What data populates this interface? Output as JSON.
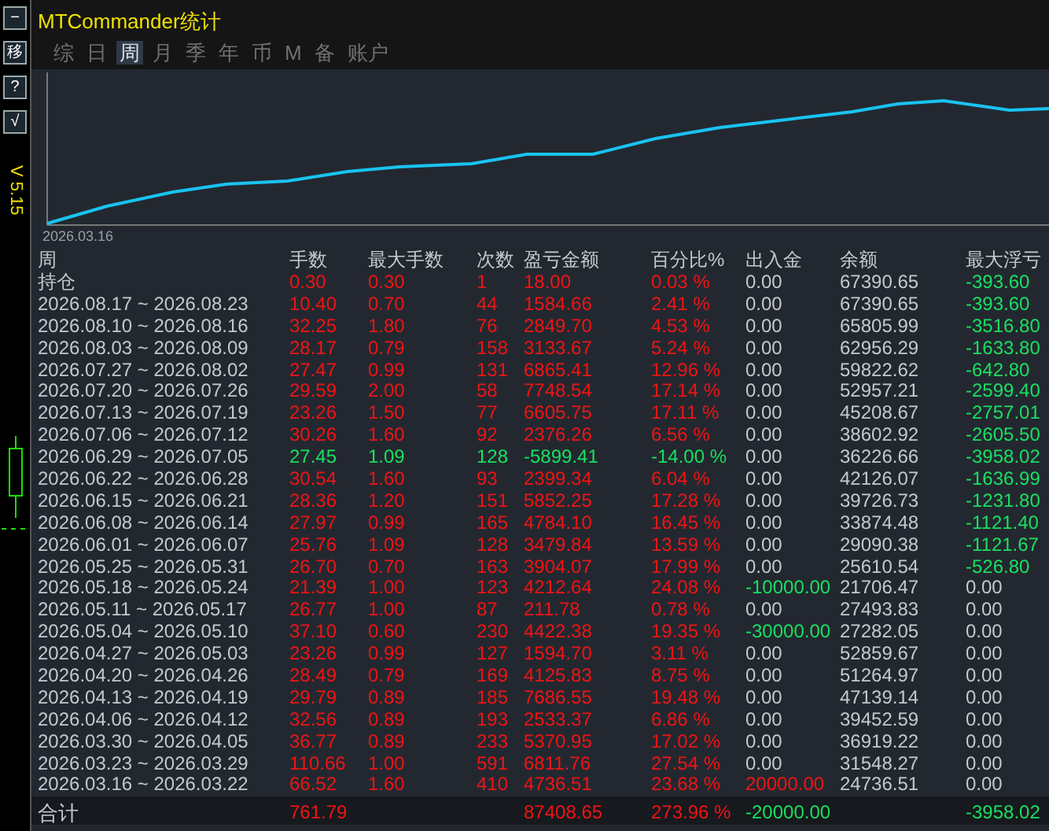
{
  "side_buttons": [
    "−",
    "移",
    "?",
    "√"
  ],
  "version": "V 5.15",
  "window": {
    "title": "MTCommander统计"
  },
  "tabs": [
    {
      "label": "综",
      "selected": false
    },
    {
      "label": "日",
      "selected": false
    },
    {
      "label": "周",
      "selected": true
    },
    {
      "label": "月",
      "selected": false
    },
    {
      "label": "季",
      "selected": false
    },
    {
      "label": "年",
      "selected": false
    },
    {
      "label": "币",
      "selected": false
    },
    {
      "label": "M",
      "selected": false
    },
    {
      "label": "备",
      "selected": false
    },
    {
      "label": "账户",
      "selected": false
    }
  ],
  "chart": {
    "start_label": "2026.03.16"
  },
  "table": {
    "columns": [
      "周",
      "手数",
      "最大手数",
      "次数",
      "盈亏金额",
      "百分比%",
      "出入金",
      "余额",
      "最大浮亏"
    ],
    "rows": [
      {
        "cells": [
          "持仓",
          "0.30",
          "0.30",
          "1",
          "18.00",
          "0.03 %",
          "0.00",
          "67390.65",
          "-393.60"
        ],
        "loss": false,
        "deposit": false,
        "withdrawal": false,
        "drawdown": true
      },
      {
        "cells": [
          "2026.08.17 ~ 2026.08.23",
          "10.40",
          "0.70",
          "44",
          "1584.66",
          "2.41 %",
          "0.00",
          "67390.65",
          "-393.60"
        ],
        "loss": false,
        "deposit": false,
        "withdrawal": false,
        "drawdown": true
      },
      {
        "cells": [
          "2026.08.10 ~ 2026.08.16",
          "32.25",
          "1.80",
          "76",
          "2849.70",
          "4.53 %",
          "0.00",
          "65805.99",
          "-3516.80"
        ],
        "loss": false,
        "deposit": false,
        "withdrawal": false,
        "drawdown": true
      },
      {
        "cells": [
          "2026.08.03 ~ 2026.08.09",
          "28.17",
          "0.79",
          "158",
          "3133.67",
          "5.24 %",
          "0.00",
          "62956.29",
          "-1633.80"
        ],
        "loss": false,
        "deposit": false,
        "withdrawal": false,
        "drawdown": true
      },
      {
        "cells": [
          "2026.07.27 ~ 2026.08.02",
          "27.47",
          "0.99",
          "131",
          "6865.41",
          "12.96 %",
          "0.00",
          "59822.62",
          "-642.80"
        ],
        "loss": false,
        "deposit": false,
        "withdrawal": false,
        "drawdown": true
      },
      {
        "cells": [
          "2026.07.20 ~ 2026.07.26",
          "29.59",
          "2.00",
          "58",
          "7748.54",
          "17.14 %",
          "0.00",
          "52957.21",
          "-2599.40"
        ],
        "loss": false,
        "deposit": false,
        "withdrawal": false,
        "drawdown": true
      },
      {
        "cells": [
          "2026.07.13 ~ 2026.07.19",
          "23.26",
          "1.50",
          "77",
          "6605.75",
          "17.11 %",
          "0.00",
          "45208.67",
          "-2757.01"
        ],
        "loss": false,
        "deposit": false,
        "withdrawal": false,
        "drawdown": true
      },
      {
        "cells": [
          "2026.07.06 ~ 2026.07.12",
          "30.26",
          "1.60",
          "92",
          "2376.26",
          "6.56 %",
          "0.00",
          "38602.92",
          "-2605.50"
        ],
        "loss": false,
        "deposit": false,
        "withdrawal": false,
        "drawdown": true
      },
      {
        "cells": [
          "2026.06.29 ~ 2026.07.05",
          "27.45",
          "1.09",
          "128",
          "-5899.41",
          "-14.00 %",
          "0.00",
          "36226.66",
          "-3958.02"
        ],
        "loss": true,
        "deposit": false,
        "withdrawal": false,
        "drawdown": true
      },
      {
        "cells": [
          "2026.06.22 ~ 2026.06.28",
          "30.54",
          "1.60",
          "93",
          "2399.34",
          "6.04 %",
          "0.00",
          "42126.07",
          "-1636.99"
        ],
        "loss": false,
        "deposit": false,
        "withdrawal": false,
        "drawdown": true
      },
      {
        "cells": [
          "2026.06.15 ~ 2026.06.21",
          "28.36",
          "1.20",
          "151",
          "5852.25",
          "17.28 %",
          "0.00",
          "39726.73",
          "-1231.80"
        ],
        "loss": false,
        "deposit": false,
        "withdrawal": false,
        "drawdown": true
      },
      {
        "cells": [
          "2026.06.08 ~ 2026.06.14",
          "27.97",
          "0.99",
          "165",
          "4784.10",
          "16.45 %",
          "0.00",
          "33874.48",
          "-1121.40"
        ],
        "loss": false,
        "deposit": false,
        "withdrawal": false,
        "drawdown": true
      },
      {
        "cells": [
          "2026.06.01 ~ 2026.06.07",
          "25.76",
          "1.09",
          "128",
          "3479.84",
          "13.59 %",
          "0.00",
          "29090.38",
          "-1121.67"
        ],
        "loss": false,
        "deposit": false,
        "withdrawal": false,
        "drawdown": true
      },
      {
        "cells": [
          "2026.05.25 ~ 2026.05.31",
          "26.70",
          "0.70",
          "163",
          "3904.07",
          "17.99 %",
          "0.00",
          "25610.54",
          "-526.80"
        ],
        "loss": false,
        "deposit": false,
        "withdrawal": false,
        "drawdown": true
      },
      {
        "cells": [
          "2026.05.18 ~ 2026.05.24",
          "21.39",
          "1.00",
          "123",
          "4212.64",
          "24.08 %",
          "-10000.00",
          "21706.47",
          "0.00"
        ],
        "loss": false,
        "deposit": false,
        "withdrawal": true,
        "drawdown": false
      },
      {
        "cells": [
          "2026.05.11 ~ 2026.05.17",
          "26.77",
          "1.00",
          "87",
          "211.78",
          "0.78 %",
          "0.00",
          "27493.83",
          "0.00"
        ],
        "loss": false,
        "deposit": false,
        "withdrawal": false,
        "drawdown": false
      },
      {
        "cells": [
          "2026.05.04 ~ 2026.05.10",
          "37.10",
          "0.60",
          "230",
          "4422.38",
          "19.35 %",
          "-30000.00",
          "27282.05",
          "0.00"
        ],
        "loss": false,
        "deposit": false,
        "withdrawal": true,
        "drawdown": false
      },
      {
        "cells": [
          "2026.04.27 ~ 2026.05.03",
          "23.26",
          "0.99",
          "127",
          "1594.70",
          "3.11 %",
          "0.00",
          "52859.67",
          "0.00"
        ],
        "loss": false,
        "deposit": false,
        "withdrawal": false,
        "drawdown": false
      },
      {
        "cells": [
          "2026.04.20 ~ 2026.04.26",
          "28.49",
          "0.79",
          "169",
          "4125.83",
          "8.75 %",
          "0.00",
          "51264.97",
          "0.00"
        ],
        "loss": false,
        "deposit": false,
        "withdrawal": false,
        "drawdown": false
      },
      {
        "cells": [
          "2026.04.13 ~ 2026.04.19",
          "29.79",
          "0.89",
          "185",
          "7686.55",
          "19.48 %",
          "0.00",
          "47139.14",
          "0.00"
        ],
        "loss": false,
        "deposit": false,
        "withdrawal": false,
        "drawdown": false
      },
      {
        "cells": [
          "2026.04.06 ~ 2026.04.12",
          "32.56",
          "0.89",
          "193",
          "2533.37",
          "6.86 %",
          "0.00",
          "39452.59",
          "0.00"
        ],
        "loss": false,
        "deposit": false,
        "withdrawal": false,
        "drawdown": false
      },
      {
        "cells": [
          "2026.03.30 ~ 2026.04.05",
          "36.77",
          "0.89",
          "233",
          "5370.95",
          "17.02 %",
          "0.00",
          "36919.22",
          "0.00"
        ],
        "loss": false,
        "deposit": false,
        "withdrawal": false,
        "drawdown": false
      },
      {
        "cells": [
          "2026.03.23 ~ 2026.03.29",
          "110.66",
          "1.00",
          "591",
          "6811.76",
          "27.54 %",
          "0.00",
          "31548.27",
          "0.00"
        ],
        "loss": false,
        "deposit": false,
        "withdrawal": false,
        "drawdown": false
      },
      {
        "cells": [
          "2026.03.16 ~ 2026.03.22",
          "66.52",
          "1.60",
          "410",
          "4736.51",
          "23.68 %",
          "20000.00",
          "24736.51",
          "0.00"
        ],
        "loss": false,
        "deposit": true,
        "withdrawal": false,
        "drawdown": false
      }
    ],
    "total": {
      "cells": [
        "合计",
        "761.79",
        "",
        "",
        "87408.65",
        "273.96 %",
        "-20000.00",
        "",
        "-3958.02"
      ],
      "loss": false,
      "deposit": false,
      "withdrawal": true,
      "drawdown": true
    }
  }
}
